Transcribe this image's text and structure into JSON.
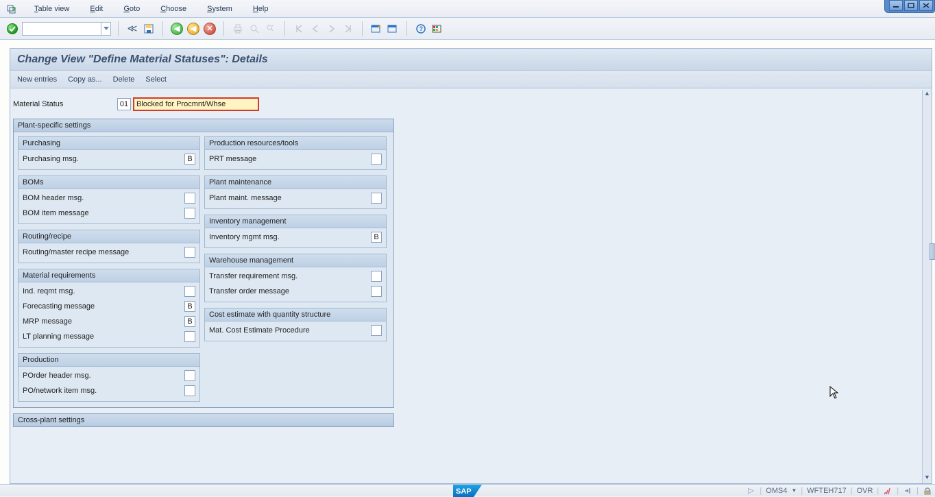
{
  "menu": {
    "items": [
      {
        "label": "Table view",
        "mnemonic": "T"
      },
      {
        "label": "Edit",
        "mnemonic": "E"
      },
      {
        "label": "Goto",
        "mnemonic": "G"
      },
      {
        "label": "Choose",
        "mnemonic": "C"
      },
      {
        "label": "System",
        "mnemonic": "S"
      },
      {
        "label": "Help",
        "mnemonic": "H"
      }
    ]
  },
  "page_title": "Change View \"Define Material Statuses\": Details",
  "actions": {
    "new_entries": "New entries",
    "copy_as": "Copy as...",
    "delete": "Delete",
    "select": "Select"
  },
  "material_status_label": "Material Status",
  "material_status_code": "01",
  "material_status_desc": "Blocked for Procmnt/Whse",
  "plant_specific_header": "Plant-specific settings",
  "left_groups": [
    {
      "key": "purchasing",
      "title": "Purchasing",
      "rows": [
        {
          "label": "Purchasing msg.",
          "value": "B"
        }
      ]
    },
    {
      "key": "boms",
      "title": "BOMs",
      "rows": [
        {
          "label": "BOM header msg.",
          "value": ""
        },
        {
          "label": "BOM item message",
          "value": ""
        }
      ]
    },
    {
      "key": "routing",
      "title": "Routing/recipe",
      "rows": [
        {
          "label": "Routing/master recipe message",
          "value": ""
        }
      ]
    },
    {
      "key": "matreq",
      "title": "Material requirements",
      "rows": [
        {
          "label": "Ind. reqmt msg.",
          "value": ""
        },
        {
          "label": "Forecasting message",
          "value": "B"
        },
        {
          "label": "MRP message",
          "value": "B"
        },
        {
          "label": "LT planning message",
          "value": ""
        }
      ]
    },
    {
      "key": "production",
      "title": "Production",
      "rows": [
        {
          "label": "POrder header msg.",
          "value": ""
        },
        {
          "label": "PO/network item msg.",
          "value": ""
        }
      ]
    }
  ],
  "right_groups": [
    {
      "key": "prt",
      "title": "Production resources/tools",
      "rows": [
        {
          "label": "PRT message",
          "value": ""
        }
      ]
    },
    {
      "key": "pm",
      "title": "Plant maintenance",
      "rows": [
        {
          "label": "Plant maint. message",
          "value": ""
        }
      ]
    },
    {
      "key": "im",
      "title": "Inventory management",
      "rows": [
        {
          "label": "Inventory mgmt msg.",
          "value": "B"
        }
      ]
    },
    {
      "key": "wm",
      "title": "Warehouse management",
      "rows": [
        {
          "label": "Transfer requirement msg.",
          "value": ""
        },
        {
          "label": "Transfer order message",
          "value": ""
        }
      ]
    },
    {
      "key": "cost",
      "title": "Cost estimate with quantity structure",
      "rows": [
        {
          "label": "Mat. Cost Estimate Procedure",
          "value": ""
        }
      ]
    }
  ],
  "cross_plant_header": "Cross-plant settings",
  "status": {
    "sap": "SAP",
    "tcode": "OMS4",
    "system": "WFTEH717",
    "mode": "OVR"
  }
}
